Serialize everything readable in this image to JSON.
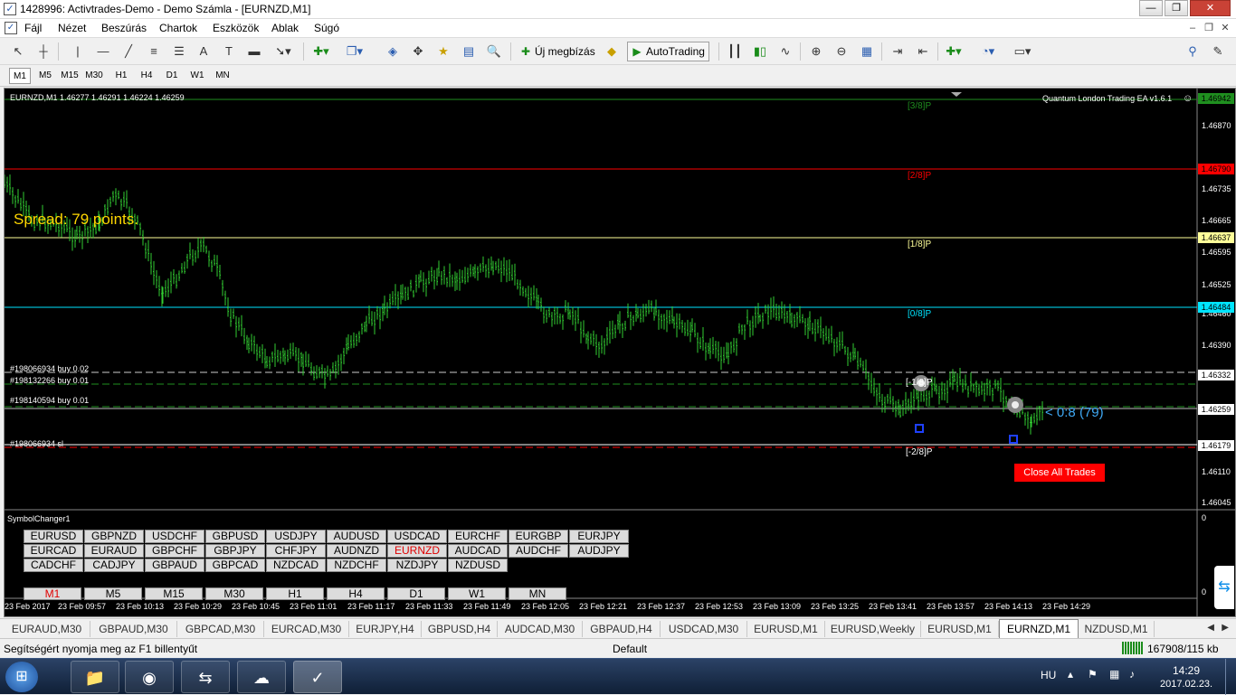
{
  "window": {
    "title": "1428996: Activtrades-Demo - Demo Számla - [EURNZD,M1]",
    "min_icon": "minimize-icon",
    "max_icon": "restore-icon",
    "close_icon": "close-icon"
  },
  "menu": {
    "items": [
      "Fájl",
      "Nézet",
      "Beszúrás",
      "Chartok",
      "Eszközök",
      "Ablak",
      "Súgó"
    ]
  },
  "toolbar": {
    "new_order_label": "Új megbízás",
    "autotrading_label": "AutoTrading"
  },
  "timeframes": {
    "items": [
      "M1",
      "M5",
      "M15",
      "M30",
      "H1",
      "H4",
      "D1",
      "W1",
      "MN"
    ],
    "active": "M1"
  },
  "chart": {
    "header": "EURNZD,M1  1.46277 1.46291 1.46224 1.46259",
    "ea_label": "Quantum London Trading EA  v1.6.1",
    "spread_text": "Spread: 79 points.",
    "price_labels": [
      "1.46870",
      "1.46735",
      "1.46665",
      "1.46595",
      "1.46525",
      "1.46460",
      "1.46390",
      "1.46320",
      "1.46110",
      "1.46045"
    ],
    "hline_labels": {
      "top": "1.46942",
      "red": "1.46790",
      "yellow": "1.46637",
      "cyan": "1.46484",
      "white1": "1.46332",
      "current": "1.46259",
      "white2": "1.46179"
    },
    "murrey_labels": {
      "m3": "[3/8]P",
      "m2": "[2/8]P",
      "m1": "[1/8]P",
      "m0": "[0/8]P",
      "mneg1": "[-1/8]P",
      "mneg2": "[-2/8]P"
    },
    "orders": {
      "o1": "#198066934 buy 0.02",
      "o2": "#198132266 buy 0.01",
      "o3": "#198140594 buy 0.01",
      "o4": "#198066934 sl"
    },
    "profit_text": "< 0:8 (79)",
    "close_all_label": "Close All Trades",
    "time_labels": [
      "23 Feb 2017",
      "23 Feb 09:57",
      "23 Feb 10:13",
      "23 Feb 10:29",
      "23 Feb 10:45",
      "23 Feb 11:01",
      "23 Feb 11:17",
      "23 Feb 11:33",
      "23 Feb 11:49",
      "23 Feb 12:05",
      "23 Feb 12:21",
      "23 Feb 12:37",
      "23 Feb 12:53",
      "23 Feb 13:09",
      "23 Feb 13:25",
      "23 Feb 13:41",
      "23 Feb 13:57",
      "23 Feb 14:13",
      "23 Feb 14:29"
    ],
    "sub_axis": {
      "top": "0",
      "bottom": "0"
    }
  },
  "symbol_changer": {
    "title": "SymbolChanger1",
    "symbols": [
      "EURUSD",
      "GBPNZD",
      "USDCHF",
      "GBPUSD",
      "USDJPY",
      "AUDUSD",
      "USDCAD",
      "EURCHF",
      "EURGBP",
      "EURJPY",
      "EURCAD",
      "EURAUD",
      "GBPCHF",
      "GBPJPY",
      "CHFJPY",
      "AUDNZD",
      "EURNZD",
      "AUDCAD",
      "AUDCHF",
      "AUDJPY",
      "CADCHF",
      "CADJPY",
      "GBPAUD",
      "GBPCAD",
      "NZDCAD",
      "NZDCHF",
      "NZDJPY",
      "NZDUSD"
    ],
    "active_symbol": "EURNZD",
    "timeframes": [
      "M1",
      "M5",
      "M15",
      "M30",
      "H1",
      "H4",
      "D1",
      "W1",
      "MN"
    ],
    "active_tf": "M1"
  },
  "tabs": {
    "items": [
      "EURAUD,M30",
      "GBPAUD,M30",
      "GBPCAD,M30",
      "EURCAD,M30",
      "EURJPY,H4",
      "GBPUSD,H4",
      "AUDCAD,M30",
      "GBPAUD,H4",
      "USDCAD,M30",
      "EURUSD,M1",
      "EURUSD,Weekly",
      "EURUSD,M1",
      "EURNZD,M1",
      "NZDUSD,M1"
    ],
    "active": "EURNZD,M1"
  },
  "status": {
    "help": "Segítségért nyomja meg az F1 billentyűt",
    "profile": "Default",
    "traffic": "167908/115 kb"
  },
  "taskbar": {
    "lang": "HU",
    "time": "14:29",
    "date": "2017.02.23."
  },
  "colors": {
    "candle": "#32cd32",
    "red_line": "#ff0000",
    "yellow_line": "#ffff99",
    "cyan_line": "#00e5ff",
    "spread_text": "#ffd700",
    "profit_text": "#3fa9f5",
    "close_btn": "#ff0000"
  }
}
